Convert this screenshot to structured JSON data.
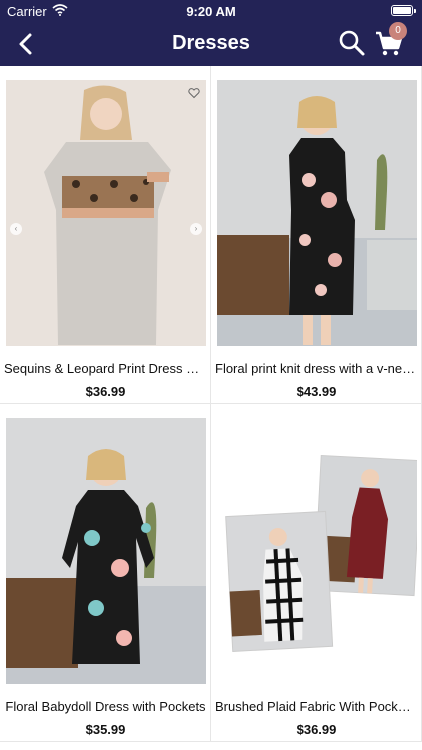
{
  "status": {
    "carrier": "Carrier",
    "time": "9:20 AM"
  },
  "nav": {
    "title": "Dresses",
    "cart_count": "0"
  },
  "products": [
    {
      "name": "Sequins & Leopard Print Dress Wi...",
      "price": "$36.99"
    },
    {
      "name": "Floral print knit dress with a v-nec...",
      "price": "$43.99"
    },
    {
      "name": "Floral Babydoll Dress with Pockets",
      "price": "$35.99"
    },
    {
      "name": "Brushed Plaid Fabric With Pocket...",
      "price": "$36.99"
    }
  ],
  "colors": {
    "header": "#232356",
    "badge": "#c9837b"
  },
  "icons": [
    "back-arrow-icon",
    "search-icon",
    "cart-icon",
    "heart-icon",
    "chevron-left-icon",
    "chevron-right-icon"
  ]
}
